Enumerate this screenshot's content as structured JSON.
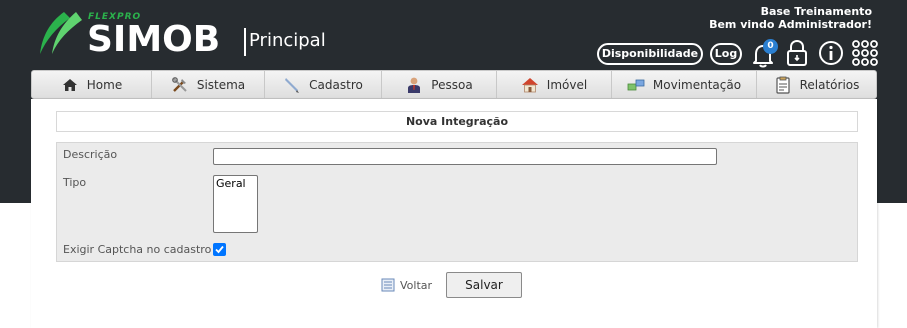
{
  "brand": {
    "tagline": "FLEXPRO",
    "name": "SIMOB",
    "section": "Principal",
    "accent_color": "#2bb24c"
  },
  "header": {
    "environment": "Base Treinamento",
    "welcome": "Bem vindo Administrador!",
    "buttons": {
      "availability": "Disponibilidade",
      "log": "Log"
    },
    "notifications_count": "0",
    "icons": [
      "bell-icon",
      "lock-icon",
      "info-icon",
      "apps-grid-icon"
    ]
  },
  "menu": {
    "items": [
      {
        "label": "Home",
        "icon": "home-icon"
      },
      {
        "label": "Sistema",
        "icon": "tools-icon"
      },
      {
        "label": "Cadastro",
        "icon": "pen-icon"
      },
      {
        "label": "Pessoa",
        "icon": "person-icon"
      },
      {
        "label": "Imóvel",
        "icon": "house-icon"
      },
      {
        "label": "Movimentação",
        "icon": "exchange-icon"
      },
      {
        "label": "Relatórios",
        "icon": "report-icon"
      }
    ]
  },
  "form": {
    "title": "Nova Integração",
    "fields": {
      "descricao_label": "Descrição",
      "descricao_value": "",
      "tipo_label": "Tipo",
      "tipo_options": [
        "Geral"
      ],
      "captcha_label": "Exigir Captcha no cadastro",
      "captcha_checked": true
    },
    "actions": {
      "back": "Voltar",
      "save": "Salvar"
    }
  }
}
